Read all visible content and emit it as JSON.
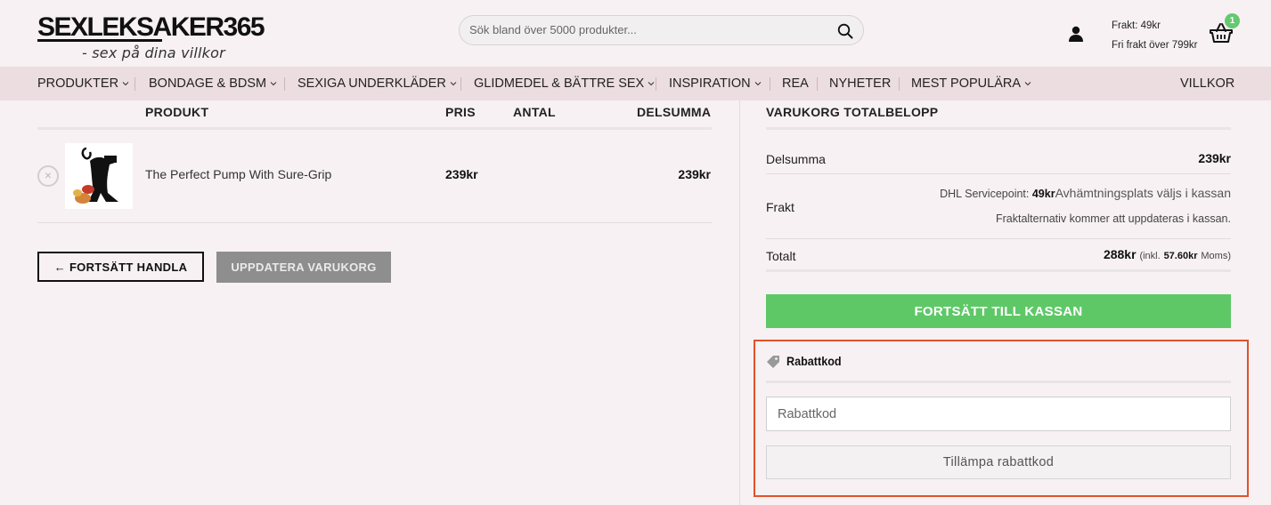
{
  "header": {
    "logo_main": "SEXLEKSAKER365",
    "logo_tagline": "- sex på dina villkor",
    "search_placeholder": "Sök bland över 5000 produkter...",
    "shipping_line1": "Frakt: 49kr",
    "shipping_line2": "Fri frakt över 799kr",
    "cart_count": "1"
  },
  "nav": {
    "items": [
      {
        "label": "PRODUKTER",
        "dropdown": true
      },
      {
        "label": "BONDAGE & BDSM",
        "dropdown": true
      },
      {
        "label": "SEXIGA UNDERKLÄDER",
        "dropdown": true
      },
      {
        "label": "GLIDMEDEL & BÄTTRE SEX",
        "dropdown": true
      },
      {
        "label": "INSPIRATION",
        "dropdown": true
      },
      {
        "label": "REA",
        "dropdown": false
      },
      {
        "label": "NYHETER",
        "dropdown": false
      },
      {
        "label": "MEST POPULÄRA",
        "dropdown": true
      }
    ],
    "right_item": "VILLKOR"
  },
  "cart": {
    "columns": [
      "PRODUKT",
      "PRIS",
      "ANTAL",
      "DELSUMMA"
    ],
    "items": [
      {
        "name": "The Perfect Pump With Sure-Grip",
        "price": "239kr",
        "subtotal": "239kr"
      }
    ],
    "continue_label": "← FORTSÄTT HANDLA",
    "update_label": "UPPDATERA VARUKORG"
  },
  "totals": {
    "title": "VARUKORG TOTALBELOPP",
    "subtotal_label": "Delsumma",
    "subtotal_value": "239kr",
    "shipping_label": "Frakt",
    "shipping_method": "DHL Servicepoint:",
    "shipping_price": "49kr",
    "shipping_note": "Avhämtningsplats väljs i kassan",
    "shipping_update_note": "Fraktalternativ kommer att uppdateras i kassan.",
    "total_label": "Totalt",
    "total_value": "288kr",
    "total_tax_prefix": "(inkl.",
    "total_tax_value": "57.60kr",
    "total_tax_suffix": "Moms)",
    "checkout_label": "FORTSÄTT TILL KASSAN"
  },
  "coupon": {
    "title": "Rabattkod",
    "input_placeholder": "Rabattkod",
    "apply_label": "Tillämpa rabattkod"
  },
  "colors": {
    "accent_green": "#5ec867",
    "highlight_border": "#e0532a",
    "nav_bg": "#ecdde1"
  }
}
